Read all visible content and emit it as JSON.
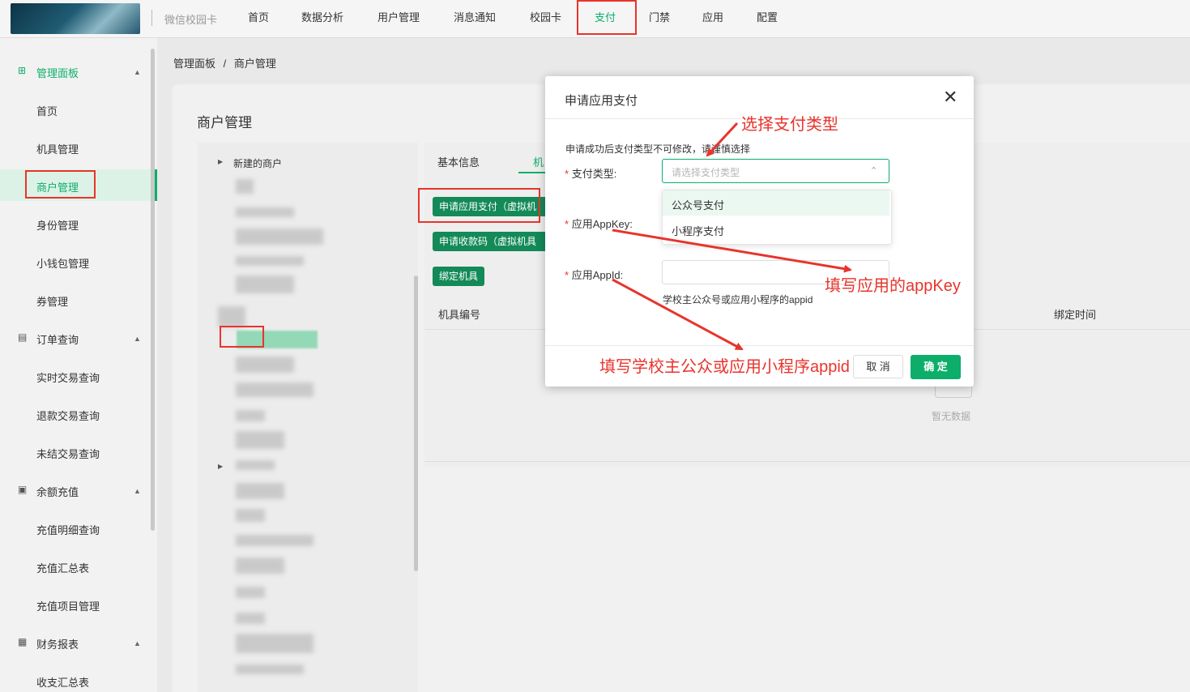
{
  "header": {
    "app_name": "微信校园卡",
    "nav": [
      "首页",
      "数据分析",
      "用户管理",
      "消息通知",
      "校园卡",
      "支付",
      "门禁",
      "应用",
      "配置"
    ],
    "active_nav": "支付"
  },
  "sidebar": {
    "groups": [
      {
        "icon": "grid-icon",
        "label": "管理面板",
        "items": [
          "首页",
          "机具管理",
          "商户管理",
          "身份管理",
          "小钱包管理",
          "券管理"
        ]
      },
      {
        "icon": "order-icon",
        "label": "订单查询",
        "items": [
          "实时交易查询",
          "退款交易查询",
          "未结交易查询"
        ]
      },
      {
        "icon": "recharge-icon",
        "label": "余额充值",
        "items": [
          "充值明细查询",
          "充值汇总表",
          "充值项目管理"
        ]
      },
      {
        "icon": "table-icon",
        "label": "财务报表",
        "items": [
          "收支汇总表"
        ]
      }
    ],
    "active_item": "商户管理"
  },
  "breadcrumb": {
    "root": "管理面板",
    "sep": "/",
    "current": "商户管理"
  },
  "page": {
    "title": "商户管理",
    "tree_first_node": "新建的商户",
    "tabs": [
      "基本信息",
      "机"
    ],
    "buttons": {
      "apply": "申请应用支付（虚拟机",
      "collect": "申请收款码（虚拟机具",
      "bind": "绑定机具"
    },
    "table": {
      "col_no": "机具编号",
      "col_time": "绑定时间",
      "empty": "暂无数据"
    }
  },
  "dialog": {
    "title": "申请应用支付",
    "note": "申请成功后支付类型不可修改，请谨慎选择",
    "required_mark": "*",
    "fields": {
      "type_label": "支付类型:",
      "type_placeholder": "请选择支付类型",
      "type_options": [
        "公众号支付",
        "小程序支付"
      ],
      "key_label": "应用AppKey:",
      "id_label": "应用AppId:",
      "id_hint": "学校主公众号或应用小程序的appid"
    },
    "cancel": "取 消",
    "ok": "确 定"
  },
  "annotations": {
    "select_type": "选择支付类型",
    "fill_key": "填写应用的appKey",
    "fill_id": "填写学校主公众或应用小程序appid",
    "color": "#e8342c"
  },
  "colors": {
    "accent": "#0cae6a",
    "button_dark_green": "#138a58",
    "highlight": "#e8342c"
  }
}
